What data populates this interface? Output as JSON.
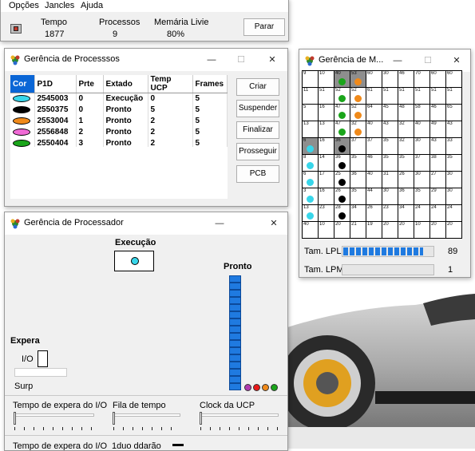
{
  "menu": [
    "Opções",
    "Jancles",
    "Ajuda"
  ],
  "stats": {
    "tempo_label": "Tempo",
    "tempo_value": "1877",
    "processos_label": "Processos",
    "processos_value": "9",
    "memoria_label": "Memária Livie",
    "memoria_value": "80%",
    "stop_label": "Parar"
  },
  "proc_window": {
    "title": "Gerência de Processsos",
    "columns": [
      "Cor",
      "P1D",
      "Prte",
      "Extado",
      "Temp UCP",
      "Frames"
    ],
    "rows": [
      {
        "color": "#38d6ea",
        "pid": "2545003",
        "prio": "0",
        "state": "Execução",
        "cpu": "0",
        "frames": "5"
      },
      {
        "color": "#000000",
        "pid": "2550375",
        "prio": "0",
        "state": "Pronto",
        "cpu": "5",
        "frames": "5"
      },
      {
        "color": "#f08a1a",
        "pid": "2553004",
        "prio": "1",
        "state": "Pronto",
        "cpu": "2",
        "frames": "5"
      },
      {
        "color": "#f06ad6",
        "pid": "2556848",
        "prio": "2",
        "state": "Pronto",
        "cpu": "2",
        "frames": "5"
      },
      {
        "color": "#1aa51a",
        "pid": "2550404",
        "prio": "3",
        "state": "Pronto",
        "cpu": "2",
        "frames": "5"
      }
    ],
    "buttons": [
      "Criar",
      "Suspender",
      "Finalizar",
      "Prosseguir",
      "PCB"
    ]
  },
  "cpu_window": {
    "title": "Gerência de Processador",
    "exec_label": "Execução",
    "ready_label": "Pronto",
    "ready_count": 16,
    "wait_label": "Expera",
    "io_label": "I/O",
    "susp_label": "Surp",
    "queue_dot_colors": [
      "#b03ab0",
      "#ea1a1a",
      "#f08a1a",
      "#1aa51a"
    ],
    "sliders": [
      {
        "label": "Tempo de expera do I/O",
        "position": 0.0
      },
      {
        "label": "Fila de tempo",
        "position": 0.0
      },
      {
        "label": "Clock da UCP",
        "position": 0.0
      }
    ],
    "bottom_labels": [
      "Tempo de expera do I/O",
      "1duo ddarão"
    ]
  },
  "mem_window": {
    "title": "Gerência de M...",
    "cells": [
      "9",
      "10",
      "40",
      "53",
      "60",
      "30",
      "46",
      "70",
      "60",
      "60",
      "11",
      "51",
      "52",
      "52",
      "61",
      "51",
      "51",
      "51",
      "51",
      "51",
      "5",
      "16",
      "47",
      "52",
      "64",
      "45",
      "48",
      "58",
      "46",
      "65",
      "13",
      "13",
      "47",
      "32",
      "40",
      "43",
      "32",
      "40",
      "49",
      "43",
      "6",
      "16",
      "36",
      "37",
      "37",
      "35",
      "32",
      "30",
      "43",
      "33",
      "8",
      "14",
      "36",
      "35",
      "46",
      "35",
      "35",
      "37",
      "38",
      "35",
      "6",
      "17",
      "25",
      "36",
      "40",
      "31",
      "26",
      "30",
      "27",
      "30",
      "3",
      "16",
      "26",
      "35",
      "44",
      "30",
      "36",
      "35",
      "29",
      "30",
      "13",
      "23",
      "28",
      "34",
      "26",
      "23",
      "34",
      "24",
      "24",
      "24",
      "40",
      "10",
      "20",
      "21",
      "19",
      "20",
      "20",
      "10",
      "20",
      "20"
    ],
    "gray_cells": [
      2,
      3,
      40,
      42
    ],
    "lpl_label": "Tam. LPL",
    "lpl_value": "89",
    "lpl_fraction": 0.89,
    "lpm_label": "Tam. LPM",
    "lpm_value": "1",
    "lpm_fraction": 0.0
  },
  "colors": {
    "selection": "#0a66d6",
    "bar": "#1f7ae0"
  }
}
